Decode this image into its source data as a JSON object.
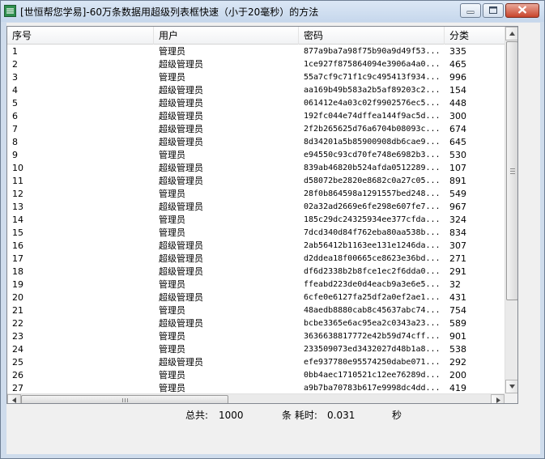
{
  "window": {
    "title": "[世恒帮您学易]-60万条数据用超级列表框快速（小于20毫秒）的方法"
  },
  "list": {
    "columns": [
      "序号",
      "用户",
      "密码",
      "分类"
    ],
    "rows": [
      [
        "1",
        "管理员",
        "877a9ba7a98f75b90a9d49f53...",
        "335"
      ],
      [
        "2",
        "超级管理员",
        "1ce927f875864094e3906a4a0...",
        "465"
      ],
      [
        "3",
        "管理员",
        "55a7cf9c71f1c9c495413f934...",
        "996"
      ],
      [
        "4",
        "超级管理员",
        "aa169b49b583a2b5af89203c2...",
        "154"
      ],
      [
        "5",
        "超级管理员",
        "061412e4a03c02f9902576ec5...",
        "448"
      ],
      [
        "6",
        "超级管理员",
        "192fc044e74dffea144f9ac5d...",
        "300"
      ],
      [
        "7",
        "超级管理员",
        "2f2b265625d76a6704b08093c...",
        "674"
      ],
      [
        "8",
        "超级管理员",
        "8d34201a5b85900908db6cae9...",
        "645"
      ],
      [
        "9",
        "管理员",
        "e94550c93cd70fe748e6982b3...",
        "530"
      ],
      [
        "10",
        "超级管理员",
        "839ab46820b524afda0512289...",
        "107"
      ],
      [
        "11",
        "超级管理员",
        "d58072be2820e8682c0a27c05...",
        "891"
      ],
      [
        "12",
        "管理员",
        "28f0b864598a1291557bed248...",
        "549"
      ],
      [
        "13",
        "超级管理员",
        "02a32ad2669e6fe298e607fe7...",
        "967"
      ],
      [
        "14",
        "管理员",
        "185c29dc24325934ee377cfda...",
        "324"
      ],
      [
        "15",
        "管理员",
        "7dcd340d84f762eba80aa538b...",
        "834"
      ],
      [
        "16",
        "超级管理员",
        "2ab56412b1163ee131e1246da...",
        "307"
      ],
      [
        "17",
        "超级管理员",
        "d2ddea18f00665ce8623e36bd...",
        "271"
      ],
      [
        "18",
        "超级管理员",
        "df6d2338b2b8fce1ec2f6dda0...",
        "291"
      ],
      [
        "19",
        "管理员",
        "ffeabd223de0d4eacb9a3e6e5...",
        "32"
      ],
      [
        "20",
        "超级管理员",
        "6cfe0e6127fa25df2a0ef2ae1...",
        "431"
      ],
      [
        "21",
        "管理员",
        "48aedb8880cab8c45637abc74...",
        "754"
      ],
      [
        "22",
        "超级管理员",
        "bcbe3365e6ac95ea2c0343a23...",
        "589"
      ],
      [
        "23",
        "管理员",
        "3636638817772e42b59d74cff...",
        "901"
      ],
      [
        "24",
        "管理员",
        "233509073ed3432027d48b1a8...",
        "538"
      ],
      [
        "25",
        "超级管理员",
        "efe937780e95574250dabe071...",
        "292"
      ],
      [
        "26",
        "管理员",
        "0bb4aec1710521c12ee76289d...",
        "200"
      ],
      [
        "27",
        "管理员",
        "a9b7ba70783b617e9998dc4dd...",
        "419"
      ]
    ]
  },
  "status": {
    "total_label": "总共:",
    "total_value": "1000",
    "count_label": "条 耗时:",
    "elapsed_value": "0.031",
    "unit": "秒"
  },
  "icons": {
    "app": "app-icon",
    "minimize": "minimize-icon",
    "maximize": "maximize-icon",
    "close": "close-icon",
    "scroll_up": "arrow-up-icon",
    "scroll_down": "arrow-down-icon",
    "scroll_left": "arrow-left-icon",
    "scroll_right": "arrow-right-icon"
  }
}
